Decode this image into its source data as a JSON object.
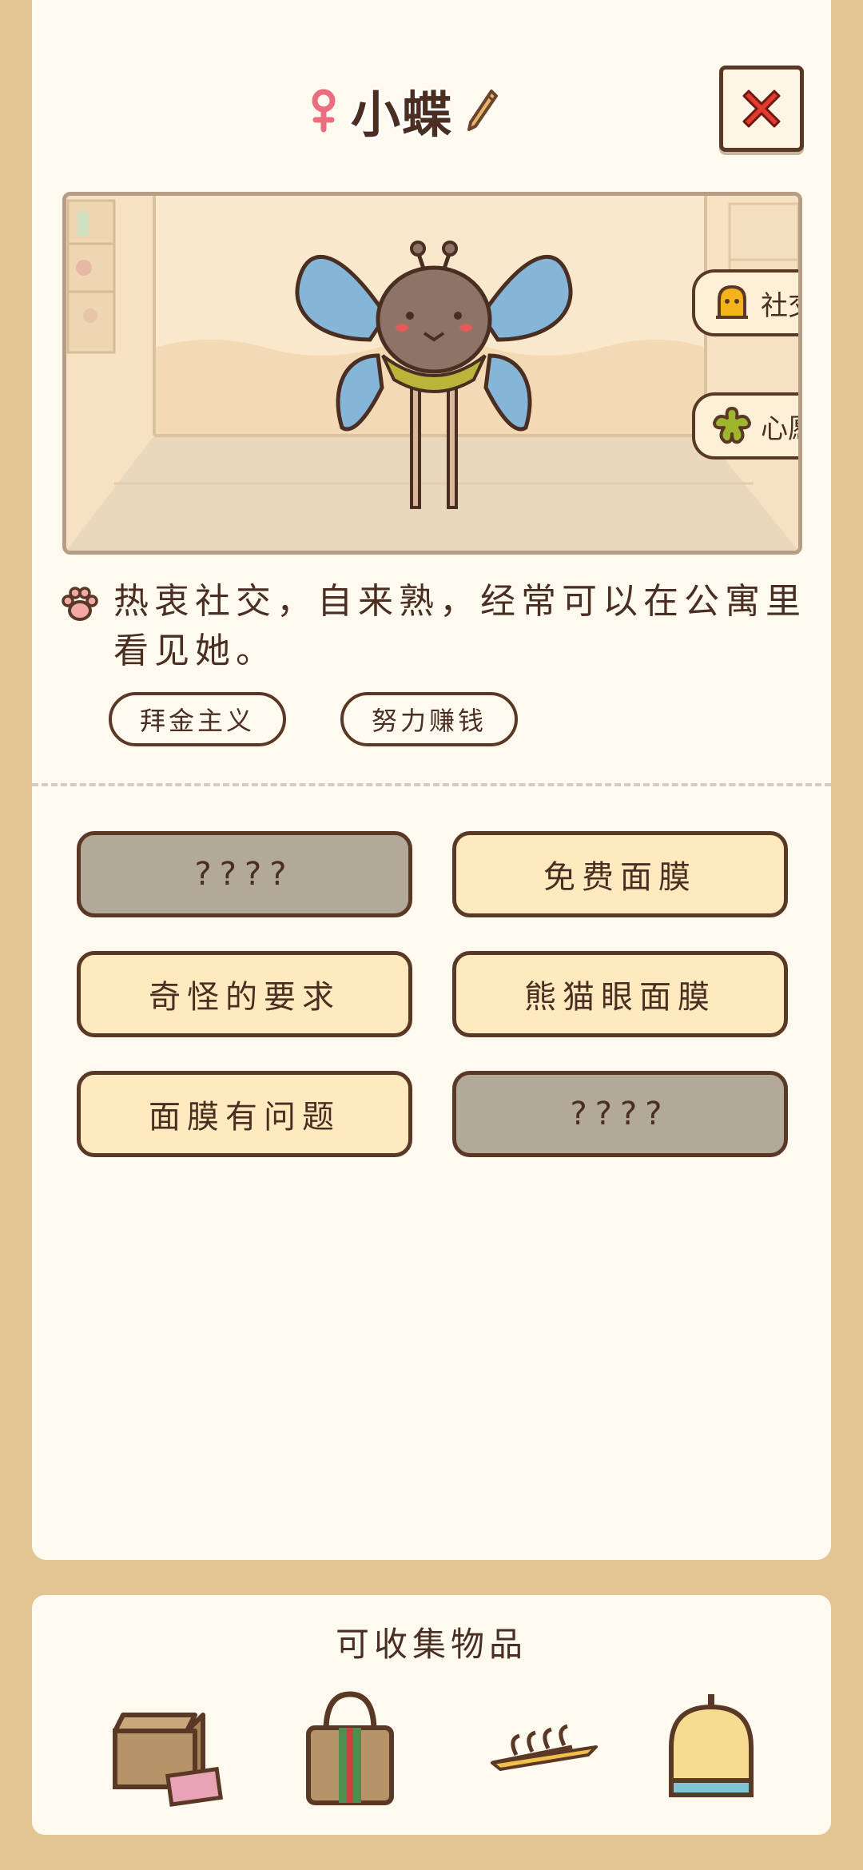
{
  "character": {
    "name": "小蝶",
    "gender_icon": "female-icon",
    "description": "热衷社交，自来熟，经常可以在公寓里看见她。",
    "tags": [
      "拜金主义",
      "努力赚钱"
    ]
  },
  "scene": {
    "side_buttons": [
      {
        "label": "社交",
        "icon": "social-icon"
      },
      {
        "label": "心愿",
        "icon": "wish-icon"
      }
    ]
  },
  "stories": [
    {
      "label": "????",
      "locked": true
    },
    {
      "label": "免费面膜",
      "locked": false
    },
    {
      "label": "奇怪的要求",
      "locked": false
    },
    {
      "label": "熊猫眼面膜",
      "locked": false
    },
    {
      "label": "面膜有问题",
      "locked": false
    },
    {
      "label": "????",
      "locked": true
    }
  ],
  "collectibles": {
    "title": "可收集物品",
    "items": [
      "box-item",
      "handbag-item",
      "hangers-item",
      "lamp-item"
    ]
  },
  "colors": {
    "background": "#e3c493",
    "panel": "#fffaf0",
    "outline": "#5a3826",
    "button_unlocked": "#ffeac0",
    "button_locked": "#b3a999",
    "close_red": "#e23a2e"
  }
}
